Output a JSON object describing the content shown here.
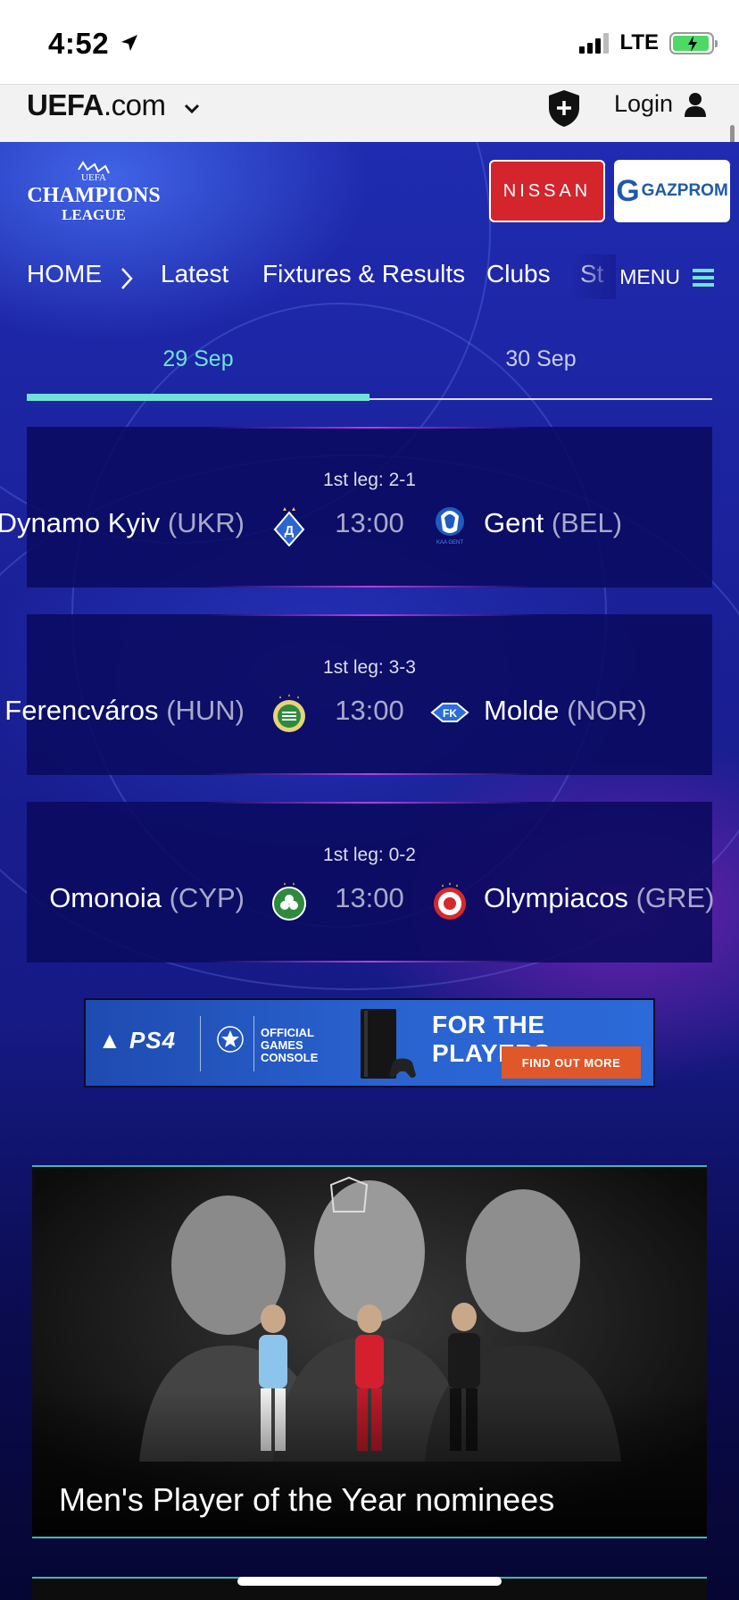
{
  "status_bar": {
    "time": "4:52",
    "network": "LTE"
  },
  "uefa_bar": {
    "logo_main": "UEFA",
    "logo_suffix": ".com",
    "login_label": "Login"
  },
  "competition": {
    "logo_line1": "UEFA",
    "logo_line2": "CHAMPIONS",
    "logo_line3": "LEAGUE"
  },
  "sponsors": {
    "nissan": "NISSAN",
    "gazprom": "GAZPROM",
    "gazprom_initial": "G"
  },
  "nav": {
    "items": [
      "HOME",
      "Latest",
      "Fixtures & Results",
      "Clubs",
      "St"
    ],
    "menu_label": "MENU"
  },
  "date_tabs": [
    {
      "label": "29 Sep",
      "active": true
    },
    {
      "label": "30 Sep",
      "active": false
    }
  ],
  "matches": [
    {
      "first_leg": "1st leg: 2-1",
      "home_team": "Dynamo Kyiv",
      "home_country": "(UKR)",
      "kickoff": "13:00",
      "away_team": "Gent",
      "away_country": "(BEL)",
      "home_crest": "dynamo-kyiv-crest",
      "away_crest": "gent-crest"
    },
    {
      "first_leg": "1st leg: 3-3",
      "home_team": "Ferencváros",
      "home_country": "(HUN)",
      "kickoff": "13:00",
      "away_team": "Molde",
      "away_country": "(NOR)",
      "home_crest": "ferencvaros-crest",
      "away_crest": "molde-crest"
    },
    {
      "first_leg": "1st leg: 0-2",
      "home_team": "Omonoia",
      "home_country": "(CYP)",
      "kickoff": "13:00",
      "away_team": "Olympiacos",
      "away_country": "(GRE)",
      "home_crest": "omonoia-crest",
      "away_crest": "olympiacos-crest"
    }
  ],
  "ad": {
    "brand": "PS4",
    "official_line1": "OFFICIAL",
    "official_line2": "GAMES",
    "official_line3": "CONSOLE",
    "headline": "FOR THE PLAYERS",
    "cta": "FIND OUT MORE"
  },
  "feature": {
    "title": "Men's Player of the Year nominees"
  },
  "colors": {
    "accent": "#6fe3d8",
    "nissan": "#d4252c",
    "gazprom": "#1f5aa8",
    "ad_cta": "#e0572a"
  }
}
